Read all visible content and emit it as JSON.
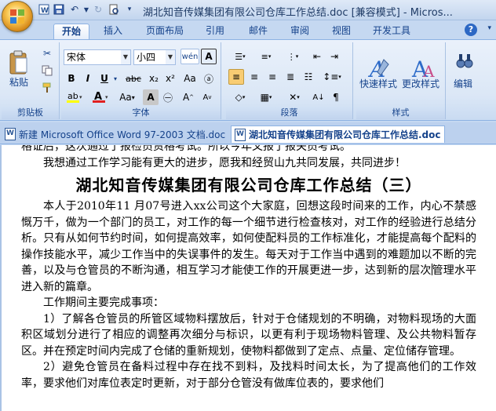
{
  "window": {
    "title": "湖北知音传媒集团有限公司仓库工作总结.doc [兼容模式] - Micros..."
  },
  "ribbon_tabs": [
    "开始",
    "插入",
    "页面布局",
    "引用",
    "邮件",
    "审阅",
    "视图",
    "开发工具"
  ],
  "font": {
    "name": "宋体",
    "size": "小四"
  },
  "groups": {
    "clipboard": "剪贴板",
    "font": "字体",
    "paragraph": "段落",
    "styles": "样式",
    "editing_label": "编辑"
  },
  "clipboard": {
    "paste_label": "粘贴"
  },
  "styles": {
    "quick_styles": "快速样式",
    "change_styles": "更改样式"
  },
  "doc_tabs": [
    "新建 Microsoft Office Word 97-2003 文档.doc",
    "湖北知音传媒集团有限公司仓库工作总结.doc"
  ],
  "document": {
    "line_top_cut": "格证后，这次通过了报检员资格考试。所以今年又报了报关员考试。",
    "p1": "我想通过工作学习能有更大的进步，愿我和经贸山九共同发展，共同进步！",
    "heading": "湖北知音传媒集团有限公司仓库工作总结（三）",
    "p2_before_caret": "本人于2010年11 月07号进入xx公司这个大家庭，回想这段时间来的工作，内心不禁感慨万千，做为一个部门的员工，对工作的每一个细节进行检查核对，对工作的经验进行总结分析。只有从如何节约时间，如何提高效率，如何使配料员的工作标准化，才能提高每个配料的操作技能水平，减少工作当中的失误事件的发生。每天对于工作当中遇到的难题加以不断的完善，以及与仓管员的不断沟通，相互学习才能使工作的开展更进一步，达到新的层次",
    "p2_after_caret": "管理水平进入新的篇章。",
    "p3": "工作期间主要完成事项：",
    "p4": "1）了解各仓管员的所管区域物料摆放后，针对于仓储规划的不明确，对物料现场的大面积区域划分进行了相应的调整再次细分与标识，以更有利于现场物料管理、及公共物料暂存区。并在预定时间内完成了仓储的重新规划，使物料都做到了定点、点量、定位储存管理。",
    "p5": "2）避免仓管员在备料过程中存在找不到料，及找料时间太长，为了提高他们的工作效率，要求他们对库位表定时更新，对于部分仓管没有做库位表的，要求他们"
  }
}
